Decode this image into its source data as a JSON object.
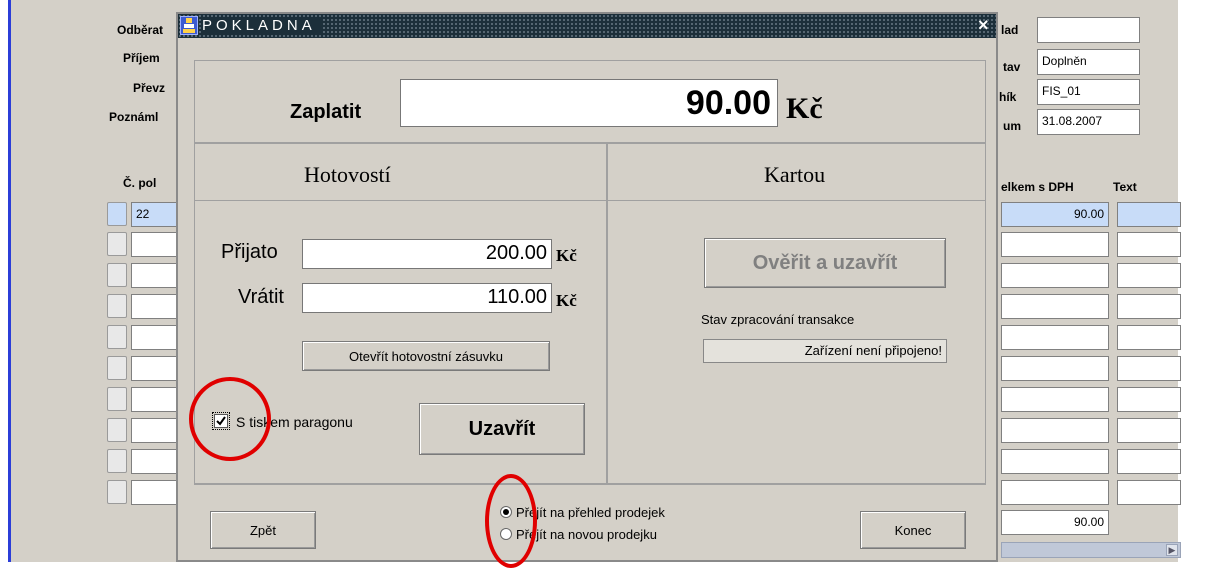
{
  "background_form": {
    "left_labels": [
      "Odběrat",
      "Příjem",
      "Převz",
      "Poznáml"
    ],
    "table_col_label": "Č. pol",
    "first_row_value": "22",
    "right_labels": [
      "lad",
      "tav",
      "hík",
      "um"
    ],
    "right_values": [
      "",
      "Doplněn",
      "FIS_01",
      "31.08.2007"
    ],
    "col_total_label": "elkem s DPH",
    "col_text_label": "Text",
    "first_row_total": "90.00",
    "sum_total": "90.00"
  },
  "dialog": {
    "title": "POKLADNA",
    "close_icon": "×",
    "pay_label": "Zaplatit",
    "pay_amount": "90.00",
    "pay_currency": "Kč",
    "cash_header": "Hotovostí",
    "card_header": "Kartou",
    "received_label": "Přijato",
    "received_value": "200.00",
    "received_currency": "Kč",
    "return_label": "Vrátit",
    "return_value": "110.00",
    "return_currency": "Kč",
    "open_drawer_button": "Otevřít hotovostní zásuvku",
    "print_checkbox_label": "S tiskem paragonu",
    "print_checked": true,
    "close_button": "Uzavřít",
    "verify_button": "Ověřit a uzavřít",
    "transaction_status_label": "Stav zpracování transakce",
    "transaction_status_value": "Zařízení není připojeno!",
    "back_button": "Zpět",
    "radio_overview": "Přejít na přehled prodejek",
    "radio_new": "Přejít na novou prodejku",
    "end_button": "Konec"
  },
  "colors": {
    "annotation_red": "#e00000",
    "titlebar": "#1c2f3a",
    "selected_row": "#c8dcf8"
  }
}
